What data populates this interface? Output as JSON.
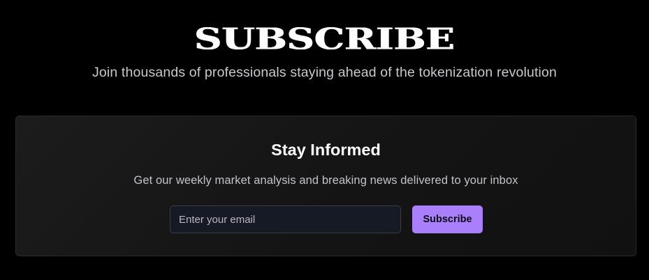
{
  "hero": {
    "title": "SUBSCRIBE",
    "subtitle": "Join thousands of professionals staying ahead of the tokenization revolution"
  },
  "newsletter": {
    "title": "Stay Informed",
    "description": "Get our weekly market analysis and breaking news delivered to your inbox",
    "email_placeholder": "Enter your email",
    "email_value": "",
    "button_label": "Subscribe"
  },
  "colors": {
    "background": "#000000",
    "card_background": "#141414",
    "accent": "#a97ffb",
    "input_background": "#161a25"
  }
}
